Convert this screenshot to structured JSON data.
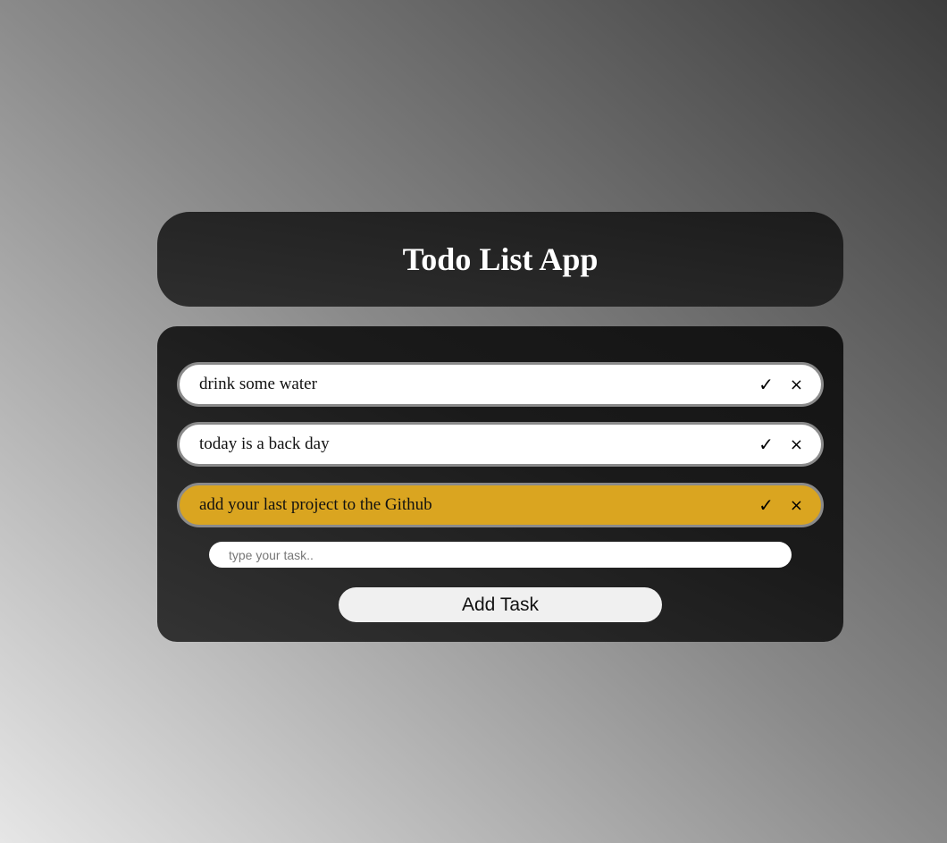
{
  "app": {
    "title": "Todo List App"
  },
  "colors": {
    "highlight": "#daa520",
    "card_dark": "#1c1c1c",
    "task_border": "#8a8a8a"
  },
  "tasks": [
    {
      "text": "drink some water",
      "done_icon": "✓",
      "delete_icon": "×",
      "highlighted": false
    },
    {
      "text": "today is a back day",
      "done_icon": "✓",
      "delete_icon": "×",
      "highlighted": false
    },
    {
      "text": "add your last project to the Github",
      "done_icon": "✓",
      "delete_icon": "×",
      "highlighted": true
    }
  ],
  "input": {
    "value": "",
    "placeholder": "type your task.."
  },
  "add_button": {
    "label": "Add Task"
  },
  "icons": {
    "done": "check-icon",
    "delete": "close-icon"
  }
}
